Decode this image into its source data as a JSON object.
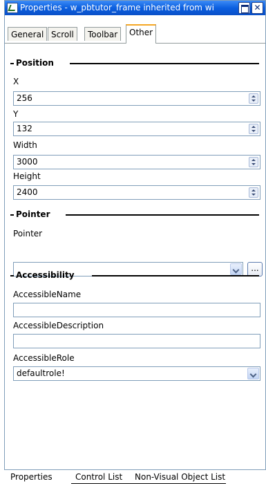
{
  "window": {
    "title": "Properties - w_pbtutor_frame inherited from wi"
  },
  "tabs": [
    "General",
    "Scroll",
    "Toolbar",
    "Other"
  ],
  "active_tab": "Other",
  "position_group": {
    "header": "Position",
    "x_label": "X",
    "x_value": "256",
    "y_label": "Y",
    "y_value": "132",
    "width_label": "Width",
    "width_value": "3000",
    "height_label": "Height",
    "height_value": "2400"
  },
  "pointer_group": {
    "header": "Pointer",
    "pointer_label": "Pointer",
    "pointer_value": "",
    "browse_label": "..."
  },
  "accessibility_group": {
    "header": "Accessibility",
    "name_label": "AccessibleName",
    "name_value": "",
    "description_label": "AccessibleDescription",
    "description_value": "",
    "role_label": "AccessibleRole",
    "role_value": "defaultrole!"
  },
  "bottom_tabs": [
    "Properties",
    "Control List",
    "Non-Visual Object List"
  ],
  "colors": {
    "titlebar": "#0b5fe0",
    "active_tab_highlight": "#f5a623",
    "input_border": "#7f9db9"
  }
}
